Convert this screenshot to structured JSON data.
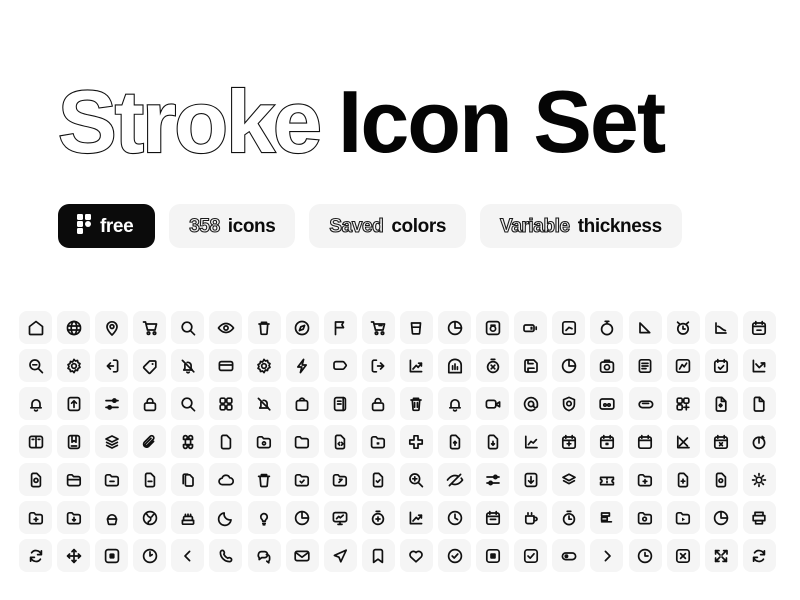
{
  "header": {
    "title_outline": "Stroke",
    "title_solid": "Icon Set"
  },
  "badges": [
    {
      "id": "free",
      "style": "dark",
      "icon": "figma-icon",
      "outline_text": "",
      "solid_text": "free"
    },
    {
      "id": "icon-count",
      "style": "light",
      "icon": "",
      "outline_text": "358",
      "solid_text": "icons"
    },
    {
      "id": "saved-colors",
      "style": "light",
      "icon": "",
      "outline_text": "Saved",
      "solid_text": "colors"
    },
    {
      "id": "variable-thickness",
      "style": "light",
      "icon": "",
      "outline_text": "Variable",
      "solid_text": "thickness"
    }
  ],
  "grid": {
    "columns": 20,
    "rows": 7,
    "total_cells": 140,
    "cell_color": "#f5f5f5",
    "stroke_color": "#111111",
    "icons": [
      "home-icon",
      "globe-icon",
      "map-pin-icon",
      "cart-icon",
      "search-icon",
      "eye-icon",
      "trash-icon",
      "compass-icon",
      "flag-icon",
      "cart-add-icon",
      "cup-icon",
      "pie-chart-icon",
      "camera-box-icon",
      "battery-icon",
      "chart-box-icon",
      "stopwatch-icon",
      "arrow-down-right-icon",
      "alarm-clock-icon",
      "chart-curve-icon",
      "calendar-icon",
      "zoom-out-icon",
      "gear-icon",
      "login-icon",
      "tag-icon",
      "bell-off-icon",
      "credit-card-icon",
      "settings-icon",
      "lightning-icon",
      "label-icon",
      "logout-icon",
      "trend-up-icon",
      "bar-chart-icon",
      "timer-off-icon",
      "save-icon",
      "pie-slice-icon",
      "camera-icon",
      "list-icon",
      "analytics-icon",
      "calendar-check-icon",
      "chart-down-icon",
      "bell-icon",
      "upload-icon",
      "sliders-icon",
      "lock-icon",
      "search-circle-icon",
      "grid-icon",
      "notification-off-icon",
      "bag-icon",
      "book-icon",
      "unlock-icon",
      "delete-icon",
      "bell-ring-icon",
      "video-icon",
      "at-icon",
      "shield-icon",
      "image-icon",
      "paperclip-icon",
      "grid-add-icon",
      "file-star-icon",
      "document-icon",
      "book-open-icon",
      "bookmark-square-icon",
      "layers-icon",
      "attachment-icon",
      "command-icon",
      "file-blank-icon",
      "folder-eye-icon",
      "folder-icon",
      "file-code-icon",
      "folder-image-icon",
      "plus-cross-icon",
      "file-up-icon",
      "file-down-icon",
      "line-chart-icon",
      "calendar-add-icon",
      "calendar-event-icon",
      "calendar-blank-icon",
      "scatter-chart-icon",
      "calendar-remove-icon",
      "timer-check-icon",
      "file-refresh-icon",
      "folder-open-icon",
      "folder-minus-icon",
      "file-minus-icon",
      "files-icon",
      "cloud-icon",
      "trash-lid-icon",
      "folder-check-icon",
      "folder-share-icon",
      "file-check-icon",
      "zoom-in-icon",
      "eye-off-icon",
      "controls-icon",
      "download-box-icon",
      "stack-icon",
      "ticket-icon",
      "folder-add-icon",
      "file-add-icon",
      "file-sync-icon",
      "sun-icon",
      "folder-plus-icon",
      "folder-download-icon",
      "cupcake-icon",
      "world-icon",
      "cake-icon",
      "moon-icon",
      "bulb-icon",
      "chart-pie-icon",
      "monitor-chart-icon",
      "timer-add-icon",
      "growth-icon",
      "clock-icon",
      "calendar-day-icon",
      "mug-icon",
      "stopwatch-2-icon",
      "chart-bars-icon",
      "folder-sync-icon",
      "folder-play-icon",
      "pie-2-icon",
      "printer-icon",
      "refresh-icon",
      "move-icon",
      "camera-square-icon",
      "clock-arrow-icon",
      "chevron-left-icon",
      "phone-icon",
      "chat-icon",
      "mail-icon",
      "send-icon",
      "bookmark-icon",
      "heart-icon",
      "check-circle-icon",
      "stop-square-icon",
      "checkbox-icon",
      "toggle-icon",
      "chevron-right-icon",
      "record-icon",
      "close-box-icon",
      "expand-icon",
      "sync-icon"
    ]
  }
}
